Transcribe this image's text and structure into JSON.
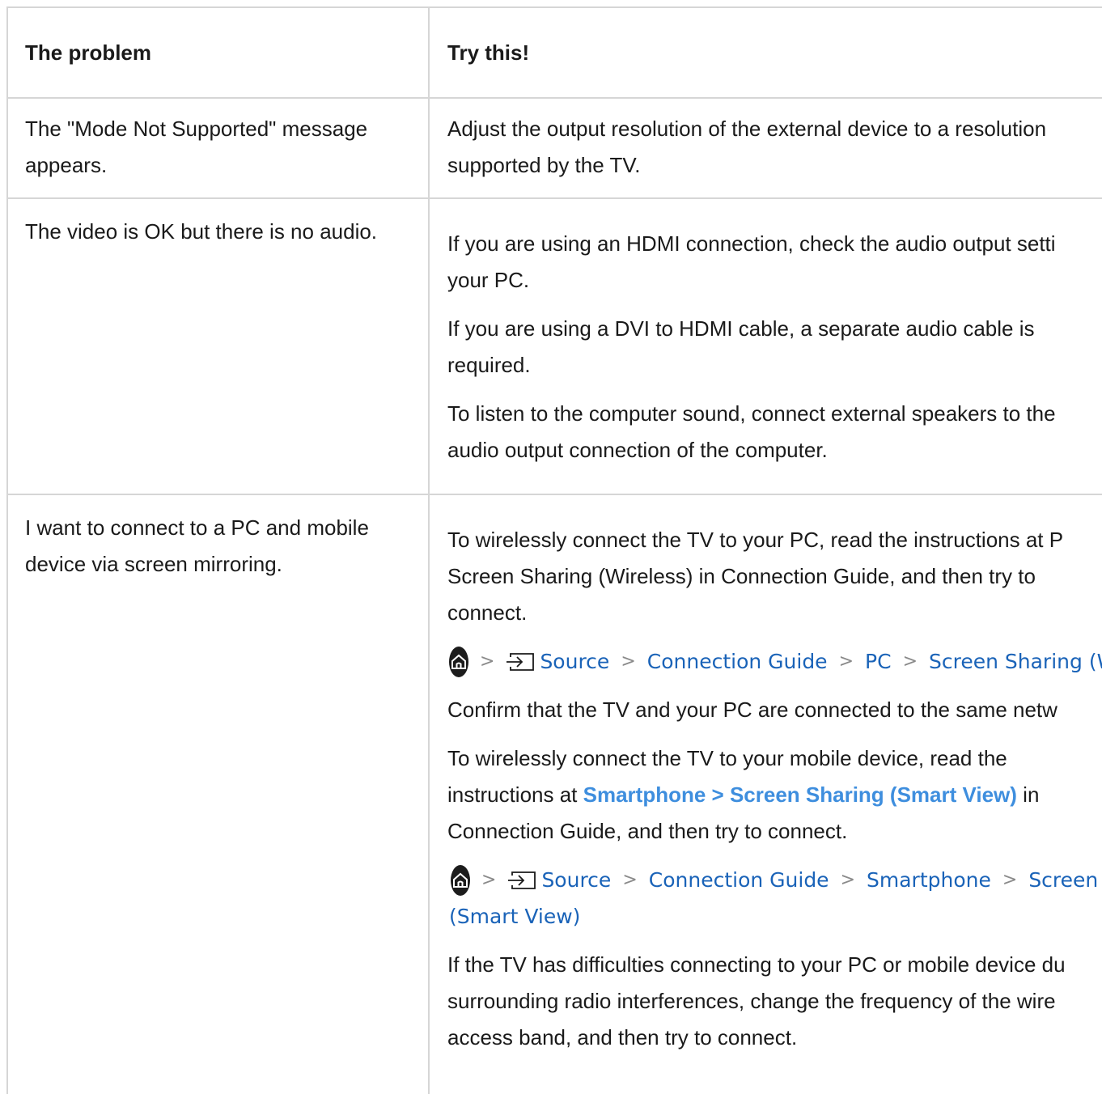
{
  "header": {
    "col1": "The problem",
    "col2": "Try this!"
  },
  "rows": [
    {
      "problem_line1": "The \"Mode Not Supported\" message",
      "problem_line2": "appears.",
      "s1_l1": "Adjust the output resolution of the external device to a resolution",
      "s1_l2": "supported by the TV."
    },
    {
      "problem_line1": "The video is OK but there is no audio.",
      "s1_l1": "If you are using an HDMI connection, check the audio output setti",
      "s1_l2": "your PC.",
      "s2_l1": "If you are using a DVI to HDMI cable, a separate audio cable is",
      "s2_l2": "required.",
      "s3_l1": "To listen to the computer sound, connect external speakers to the",
      "s3_l2": "audio output connection of the computer."
    },
    {
      "problem_line1": "I want to connect to a PC and mobile",
      "problem_line2": "device via screen mirroring.",
      "s1_l1": "To wirelessly connect the TV to your PC, read the instructions at P",
      "s1_l2": "Screen Sharing (Wireless) in Connection Guide, and then try to",
      "s1_l3": "connect.",
      "path1": [
        "Source",
        "Connection Guide",
        "PC",
        "Screen Sharing (Wireles"
      ],
      "s2_l1": "Confirm that the TV and your PC are connected to the same netw",
      "s3_l1": "To wirelessly connect the TV to your mobile device, read the",
      "s3_l2_pre": "instructions at ",
      "s3_l2_link": "Smartphone > Screen Sharing (Smart View)",
      "s3_l2_post": " in",
      "s3_l3": "Connection Guide, and then try to connect.",
      "path2": [
        "Source",
        "Connection Guide",
        "Smartphone",
        "Screen Shari"
      ],
      "path2_cont": "(Smart View)",
      "s4_l1": "If the TV has difficulties connecting to your PC or mobile device du",
      "s4_l2": "surrounding radio interferences, change the frequency of the wire",
      "s4_l3": "access band, and then try to connect."
    }
  ],
  "icons": {
    "home": "home-icon",
    "source": "source-input-icon",
    "chevron": "chevron-right-icon"
  },
  "colors": {
    "border": "#d6d6d6",
    "path_link": "#1a63b8",
    "bold_link": "#3e8ede",
    "text": "#1a1a1a"
  }
}
